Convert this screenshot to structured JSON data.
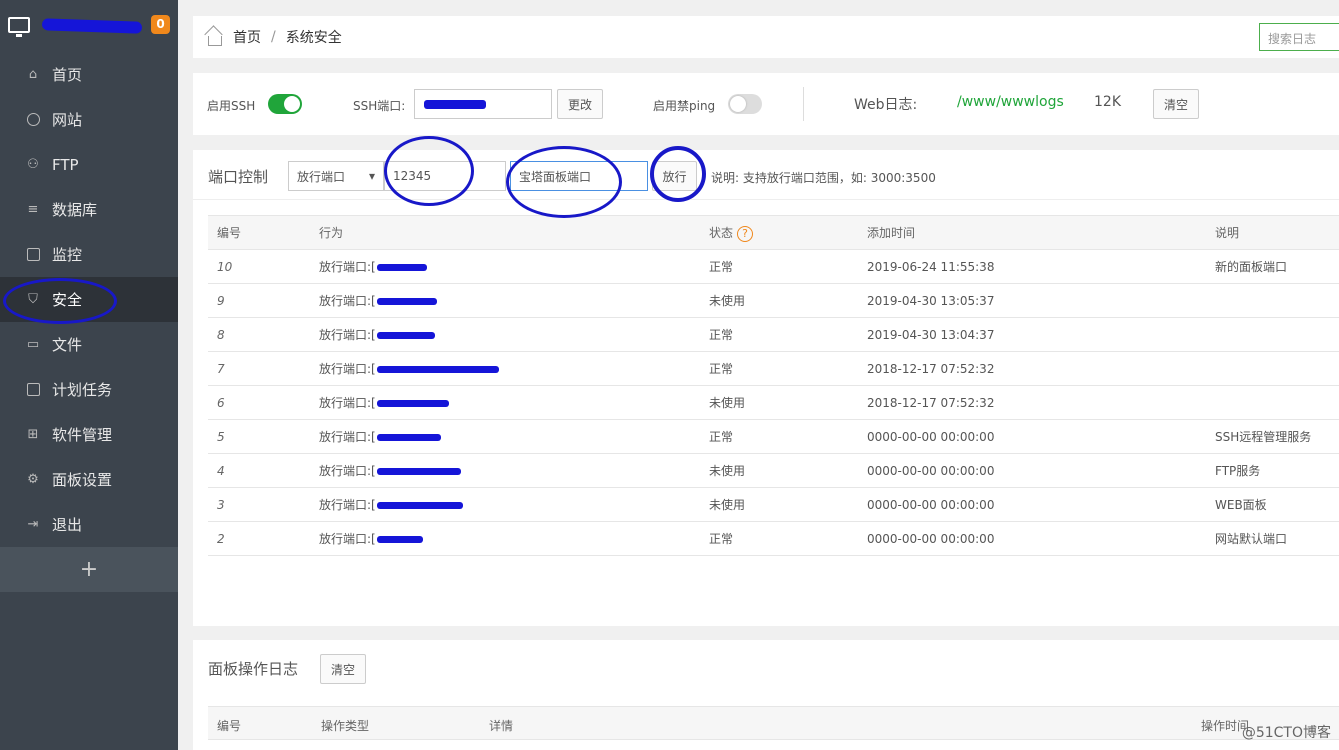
{
  "sidebar": {
    "badge": "0",
    "items": [
      {
        "label": "首页",
        "icon": "home-icon"
      },
      {
        "label": "网站",
        "icon": "globe-icon"
      },
      {
        "label": "FTP",
        "icon": "ftp-user-icon"
      },
      {
        "label": "数据库",
        "icon": "database-icon"
      },
      {
        "label": "监控",
        "icon": "monitor-chart-icon"
      },
      {
        "label": "安全",
        "icon": "shield-icon"
      },
      {
        "label": "文件",
        "icon": "folder-icon"
      },
      {
        "label": "计划任务",
        "icon": "calendar-icon"
      },
      {
        "label": "软件管理",
        "icon": "grid-icon"
      },
      {
        "label": "面板设置",
        "icon": "gear-icon"
      },
      {
        "label": "退出",
        "icon": "logout-icon"
      }
    ],
    "add_label": "+"
  },
  "breadcrumb": {
    "home": "首页",
    "sep": "/",
    "current": "系统安全"
  },
  "search_log_placeholder": "搜索日志",
  "ssh": {
    "enable_label": "启用SSH",
    "port_label": "SSH端口:",
    "change_button": "更改",
    "ping_label": "启用禁ping",
    "weblog_label": "Web日志:",
    "weblog_path": "/www/wwwlogs",
    "weblog_size": "12K",
    "clear_button": "清空"
  },
  "port_control": {
    "title": "端口控制",
    "select_value": "放行端口",
    "port_value": "12345",
    "desc_value": "宝塔面板端口",
    "allow_button": "放行",
    "note": "说明: 支持放行端口范围，如: 3000:3500"
  },
  "table": {
    "headers": [
      "编号",
      "行为",
      "状态",
      "添加时间",
      "说明"
    ],
    "rows": [
      {
        "id": "10",
        "action": "放行端口:[",
        "status": "正常",
        "time": "2019-06-24 11:55:38",
        "note": "新的面板端口"
      },
      {
        "id": "9",
        "action": "放行端口:[",
        "status": "未使用",
        "time": "2019-04-30 13:05:37",
        "note": ""
      },
      {
        "id": "8",
        "action": "放行端口:[",
        "status": "正常",
        "time": "2019-04-30 13:04:37",
        "note": ""
      },
      {
        "id": "7",
        "action": "放行端口:[",
        "status": "正常",
        "time": "2018-12-17 07:52:32",
        "note": ""
      },
      {
        "id": "6",
        "action": "放行端口:[",
        "status": "未使用",
        "time": "2018-12-17 07:52:32",
        "note": ""
      },
      {
        "id": "5",
        "action": "放行端口:[",
        "status": "正常",
        "time": "0000-00-00 00:00:00",
        "note": "SSH远程管理服务"
      },
      {
        "id": "4",
        "action": "放行端口:[",
        "status": "未使用",
        "time": "0000-00-00 00:00:00",
        "note": "FTP服务"
      },
      {
        "id": "3",
        "action": "放行端口:[",
        "status": "未使用",
        "time": "0000-00-00 00:00:00",
        "note": "WEB面板"
      },
      {
        "id": "2",
        "action": "放行端口:[",
        "status": "正常",
        "time": "0000-00-00 00:00:00",
        "note": "网站默认端口"
      }
    ]
  },
  "log": {
    "title": "面板操作日志",
    "clear_button": "清空",
    "headers": [
      "编号",
      "操作类型",
      "详情",
      "操作时间"
    ]
  },
  "watermark": "@51CTO博客",
  "colors": {
    "accent_green": "#20a53a",
    "sidebar_bg": "#3c444d",
    "badge_orange": "#f0881c",
    "annotation_blue": "#1818c8"
  }
}
